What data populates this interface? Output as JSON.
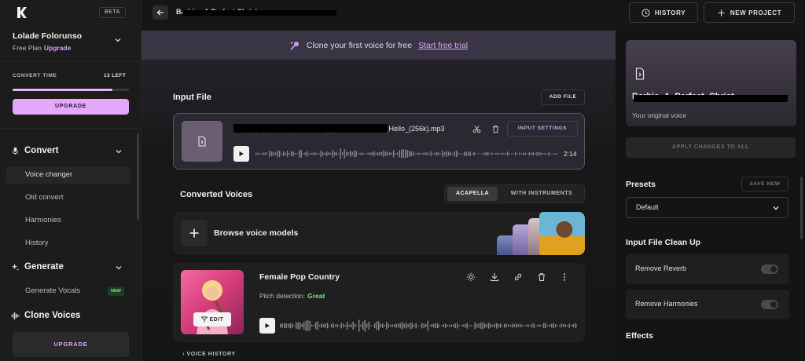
{
  "sidebar": {
    "beta_badge": "BETA",
    "user_name": "Lolade Folorunso",
    "plan": "Free Plan",
    "plan_upgrade": "Upgrade",
    "convert_time_label": "CONVERT TIME",
    "convert_time_left": "13 LEFT",
    "convert_time_fraction": 0.86,
    "upgrade_button": "UPGRADE",
    "sections": {
      "convert": "Convert",
      "generate": "Generate",
      "clone": "Clone Voices"
    },
    "convert_items": [
      "Voice changer",
      "Old convert",
      "Harmonies",
      "History"
    ],
    "generate_items": [
      "Generate Vocals"
    ],
    "new_badge": "NEW",
    "bottom_upgrade": "UPGRADE"
  },
  "topbar": {
    "project_title": "Barbie - A Perfect Christ",
    "history_button": "HISTORY",
    "new_project_button": "NEW PROJECT"
  },
  "banner": {
    "text": "Clone your first voice for free",
    "link": "Start free trial"
  },
  "input_file": {
    "heading": "Input File",
    "add_file_button": "ADD FILE",
    "file_name": "Barbie_A_Perfect_Christmas___BarbieYouTube_Hello_(256k).mp3",
    "input_settings_button": "INPUT SETTINGS",
    "duration": "2:14"
  },
  "converted": {
    "heading": "Converted Voices",
    "tab_acapella": "ACAPELLA",
    "tab_with_instruments": "WITH INSTRUMENTS",
    "browse_label": "Browse voice models"
  },
  "voice_card": {
    "name": "Female Pop Country",
    "pitch_label": "Pitch detection:",
    "pitch_value": "Great",
    "edit_button": "EDIT",
    "voice_history": "VOICE HISTORY"
  },
  "right_panel": {
    "output_title": "Barbie_A_Perfect_Christ",
    "output_subtitle": "Your original voice",
    "apply_button": "APPLY CHANGES TO ALL",
    "presets_heading": "Presets",
    "save_new_button": "SAVE NEW",
    "preset_selected": "Default",
    "cleanup_heading": "Input File Clean Up",
    "remove_reverb": "Remove Reverb",
    "remove_harmonies": "Remove Harmonies",
    "effects_heading": "Effects"
  },
  "colors": {
    "accent": "#e3a7fc",
    "link": "#d6a5f7",
    "success": "#7ee08a"
  }
}
